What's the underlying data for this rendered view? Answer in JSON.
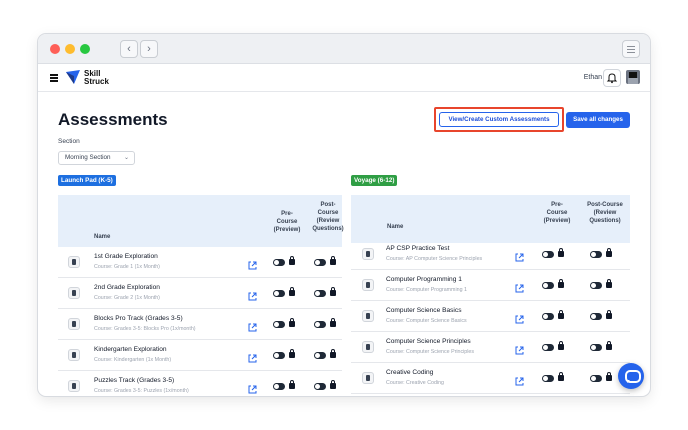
{
  "app": {
    "logo_line1": "Skill",
    "logo_line2": "Struck",
    "user_name": "Ethan"
  },
  "colors": {
    "primary": "#2563eb",
    "launchpad": "#1d6fe0",
    "voyage": "#2f9e44",
    "highlight": "#e8452c"
  },
  "header": {
    "title": "Assessments",
    "custom_button": "View/Create Custom Assessments",
    "save_button": "Save all changes"
  },
  "filters": {
    "section_label": "Section",
    "section_value": "Morning Section"
  },
  "launchpad": {
    "badge": "Launch Pad (K-5)",
    "col_name": "Name",
    "col_pre": [
      "Pre-",
      "Course",
      "(Preview)"
    ],
    "col_post": [
      "Post-",
      "Course",
      "(Review",
      "Questions)"
    ],
    "rows": [
      {
        "name": "1st Grade Exploration",
        "course": "Course: Grade 1 (1x Month)"
      },
      {
        "name": "2nd Grade Exploration",
        "course": "Course: Grade 2 (1x Month)"
      },
      {
        "name": "Blocks Pro Track (Grades 3-5)",
        "course": "Course: Grades 3-5: Blocks Pro (1x/month)"
      },
      {
        "name": "Kindergarten Exploration",
        "course": "Course: Kindergarten (1x Month)"
      },
      {
        "name": "Puzzles Track (Grades 3-5)",
        "course": "Course: Grades 3-5: Puzzles (1x/month)"
      }
    ]
  },
  "voyage": {
    "badge": "Voyage (6-12)",
    "col_name": "Name",
    "col_pre": [
      "Pre-",
      "Course",
      "(Preview)"
    ],
    "col_post": [
      "Post-Course",
      "(Review",
      "Questions)"
    ],
    "rows": [
      {
        "name": "AP CSP Practice Test",
        "course": "Course: AP Computer Science Principles"
      },
      {
        "name": "Computer Programming 1",
        "course": "Course: Computer Programming 1"
      },
      {
        "name": "Computer Science Basics",
        "course": "Course: Computer Science Basics"
      },
      {
        "name": "Computer Science Principles",
        "course": "Course: Computer Science Principles"
      },
      {
        "name": "Creative Coding",
        "course": "Course: Creative Coding"
      }
    ]
  }
}
